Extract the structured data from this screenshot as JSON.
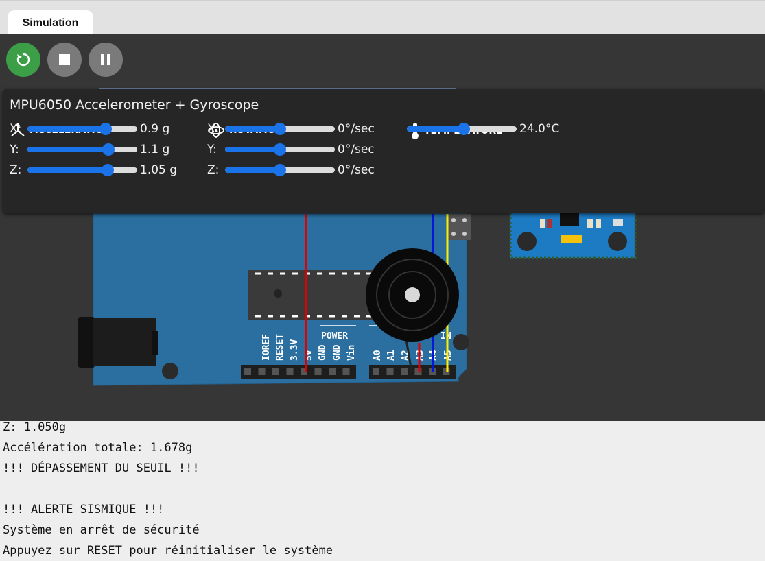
{
  "tabs": [
    {
      "label": "Simulation"
    }
  ],
  "controls": {
    "restart_icon": "restart-icon",
    "stop_icon": "stop-icon",
    "pause_icon": "pause-icon"
  },
  "board": {
    "power_header": "POWER",
    "analog_header": "IN",
    "power_pins": [
      "IOREF",
      "RESET",
      "3.3V",
      "5V",
      "GND",
      "GND",
      "Vin"
    ],
    "analog_pins": [
      "A0",
      "A1",
      "A2",
      "A3",
      "A4",
      "A5"
    ]
  },
  "sensor_panel": {
    "title": "MPU6050 Accelerometer + Gyroscope",
    "acceleration": {
      "label": "ACCELERATION",
      "icon": "axes-icon",
      "x": {
        "axis": "X:",
        "value": "0.9 g",
        "level": 0.71
      },
      "y": {
        "axis": "Y:",
        "value": "1.1 g",
        "level": 0.74
      },
      "z": {
        "axis": "Z:",
        "value": "1.05 g",
        "level": 0.73
      }
    },
    "rotation": {
      "label": "ROTATION",
      "icon": "rotation-icon",
      "x": {
        "axis": "X:",
        "value": "0°/sec",
        "level": 0.5
      },
      "y": {
        "axis": "Y:",
        "value": "0°/sec",
        "level": 0.5
      },
      "z": {
        "axis": "Z:",
        "value": "0°/sec",
        "level": 0.5
      }
    },
    "temperature": {
      "label": "TEMPERATURE",
      "icon": "thermometer-icon",
      "value": "24.0°C",
      "level": 0.52
    }
  },
  "serial_monitor": {
    "lines": [
      "Z: 1.050g",
      "Accélération totale: 1.678g",
      "!!! DÉPASSEMENT DU SEUIL !!!",
      "",
      "!!! ALERTE SISMIQUE !!!",
      "Système en arrêt de sécurité",
      "Appuyez sur RESET pour réinitialiser le système"
    ]
  },
  "colors": {
    "accent": "#1a73e8",
    "restart": "#3d9e48",
    "board": "#2a6fa0",
    "wire_red": "#e00000",
    "wire_blue": "#0018d8",
    "wire_yellow": "#ffee00"
  }
}
